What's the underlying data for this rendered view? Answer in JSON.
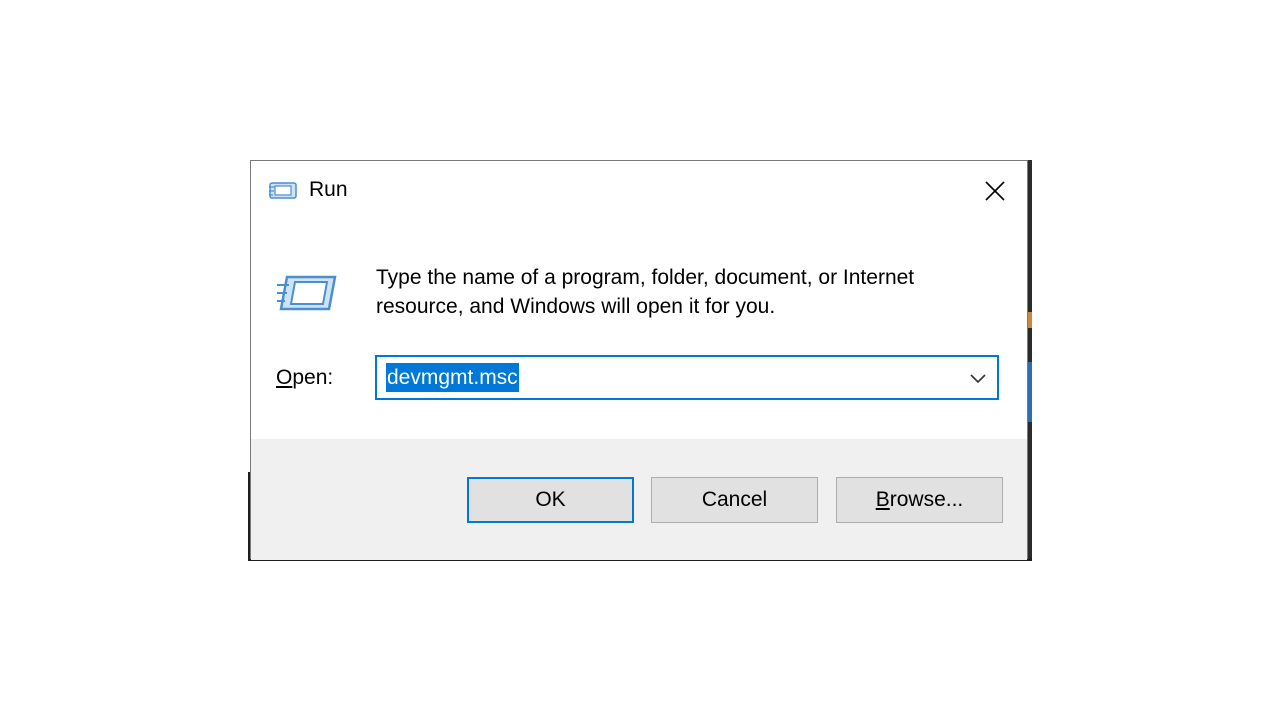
{
  "window": {
    "title": "Run",
    "icon": "run-icon",
    "close_icon": "close-icon"
  },
  "content": {
    "description_line1": "Type the name of a program, folder, document, or Internet",
    "description_line2": "resource, and Windows will open it for you.",
    "open_label_mnemonic": "O",
    "open_label_rest": "pen:",
    "input_value": "devmgmt.msc",
    "dropdown_icon": "chevron-down-icon"
  },
  "buttons": {
    "ok": "OK",
    "cancel": "Cancel",
    "browse_mnemonic": "B",
    "browse_rest": "rowse..."
  },
  "colors": {
    "accent": "#0078d7",
    "footer_bg": "#f0f0f0",
    "button_bg": "#e1e1e1"
  }
}
